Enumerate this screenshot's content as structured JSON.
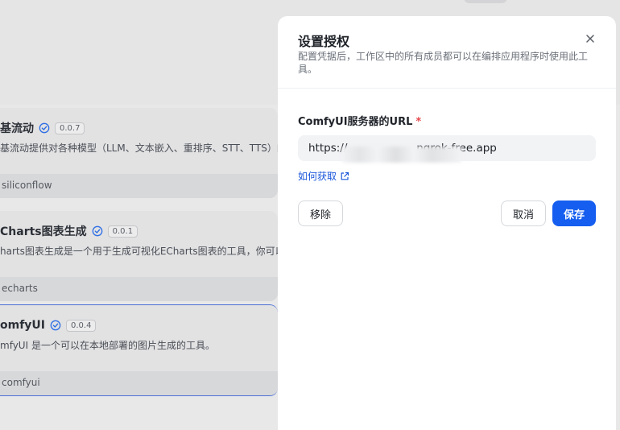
{
  "background": {
    "plugins": [
      {
        "name": "基流动",
        "version": "0.0.7",
        "description": "基流动提供对各种模型（LLM、文本嵌入、重排序、STT、TTS）的",
        "author": "siliconflow"
      },
      {
        "name": "Charts图表生成",
        "version": "0.0.1",
        "description": "harts图表生成是一个用于生成可视化ECharts图表的工具，你可以",
        "author": "echarts"
      },
      {
        "name": "omfyUI",
        "version": "0.0.4",
        "description": "mfyUI 是一个可以在本地部署的图片生成的工具。",
        "author": "comfyui"
      }
    ]
  },
  "modal": {
    "title": "设置授权",
    "subtitle": "配置凭据后，工作区中的所有成员都可以在编排应用程序时使用此工具。",
    "field": {
      "label": "ComfyUI服务器的URL",
      "required_mark": "*",
      "value": "https://                    ngrok-free.app"
    },
    "help_link": "如何获取",
    "buttons": {
      "remove": "移除",
      "cancel": "取消",
      "save": "保存"
    }
  },
  "colors": {
    "primary": "#155eef",
    "link": "#1a56db",
    "required": "#e5484d",
    "verified": "#2f6fe4"
  }
}
